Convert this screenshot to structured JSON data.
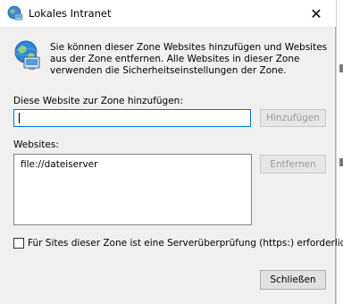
{
  "window": {
    "title": "Lokales Intranet",
    "title_icon": "intranet-globe-icon",
    "close_glyph": "✕"
  },
  "intro": {
    "icon": "globe-computer-icon",
    "text": "Sie können dieser Zone Websites hinzufügen und Websites aus der Zone entfernen. Alle Websites in dieser Zone verwenden die Sicherheitseinstellungen der Zone."
  },
  "add_site": {
    "label": "Diese Website zur Zone hinzufügen:",
    "value": "",
    "button": "Hinzufügen",
    "button_enabled": false
  },
  "websites": {
    "label": "Websites:",
    "items": [
      "file://dateiserver"
    ],
    "remove_button": "Entfernen",
    "remove_enabled": false
  },
  "https_check": {
    "label": "Für Sites dieser Zone ist eine Serverüberprüfung (https:) erforderlich",
    "checked": false
  },
  "close_button": "Schließen",
  "colors": {
    "dialog_bg": "#f0f0f0",
    "focus_border": "#0078d7",
    "disabled_text": "#9a9a9a"
  }
}
